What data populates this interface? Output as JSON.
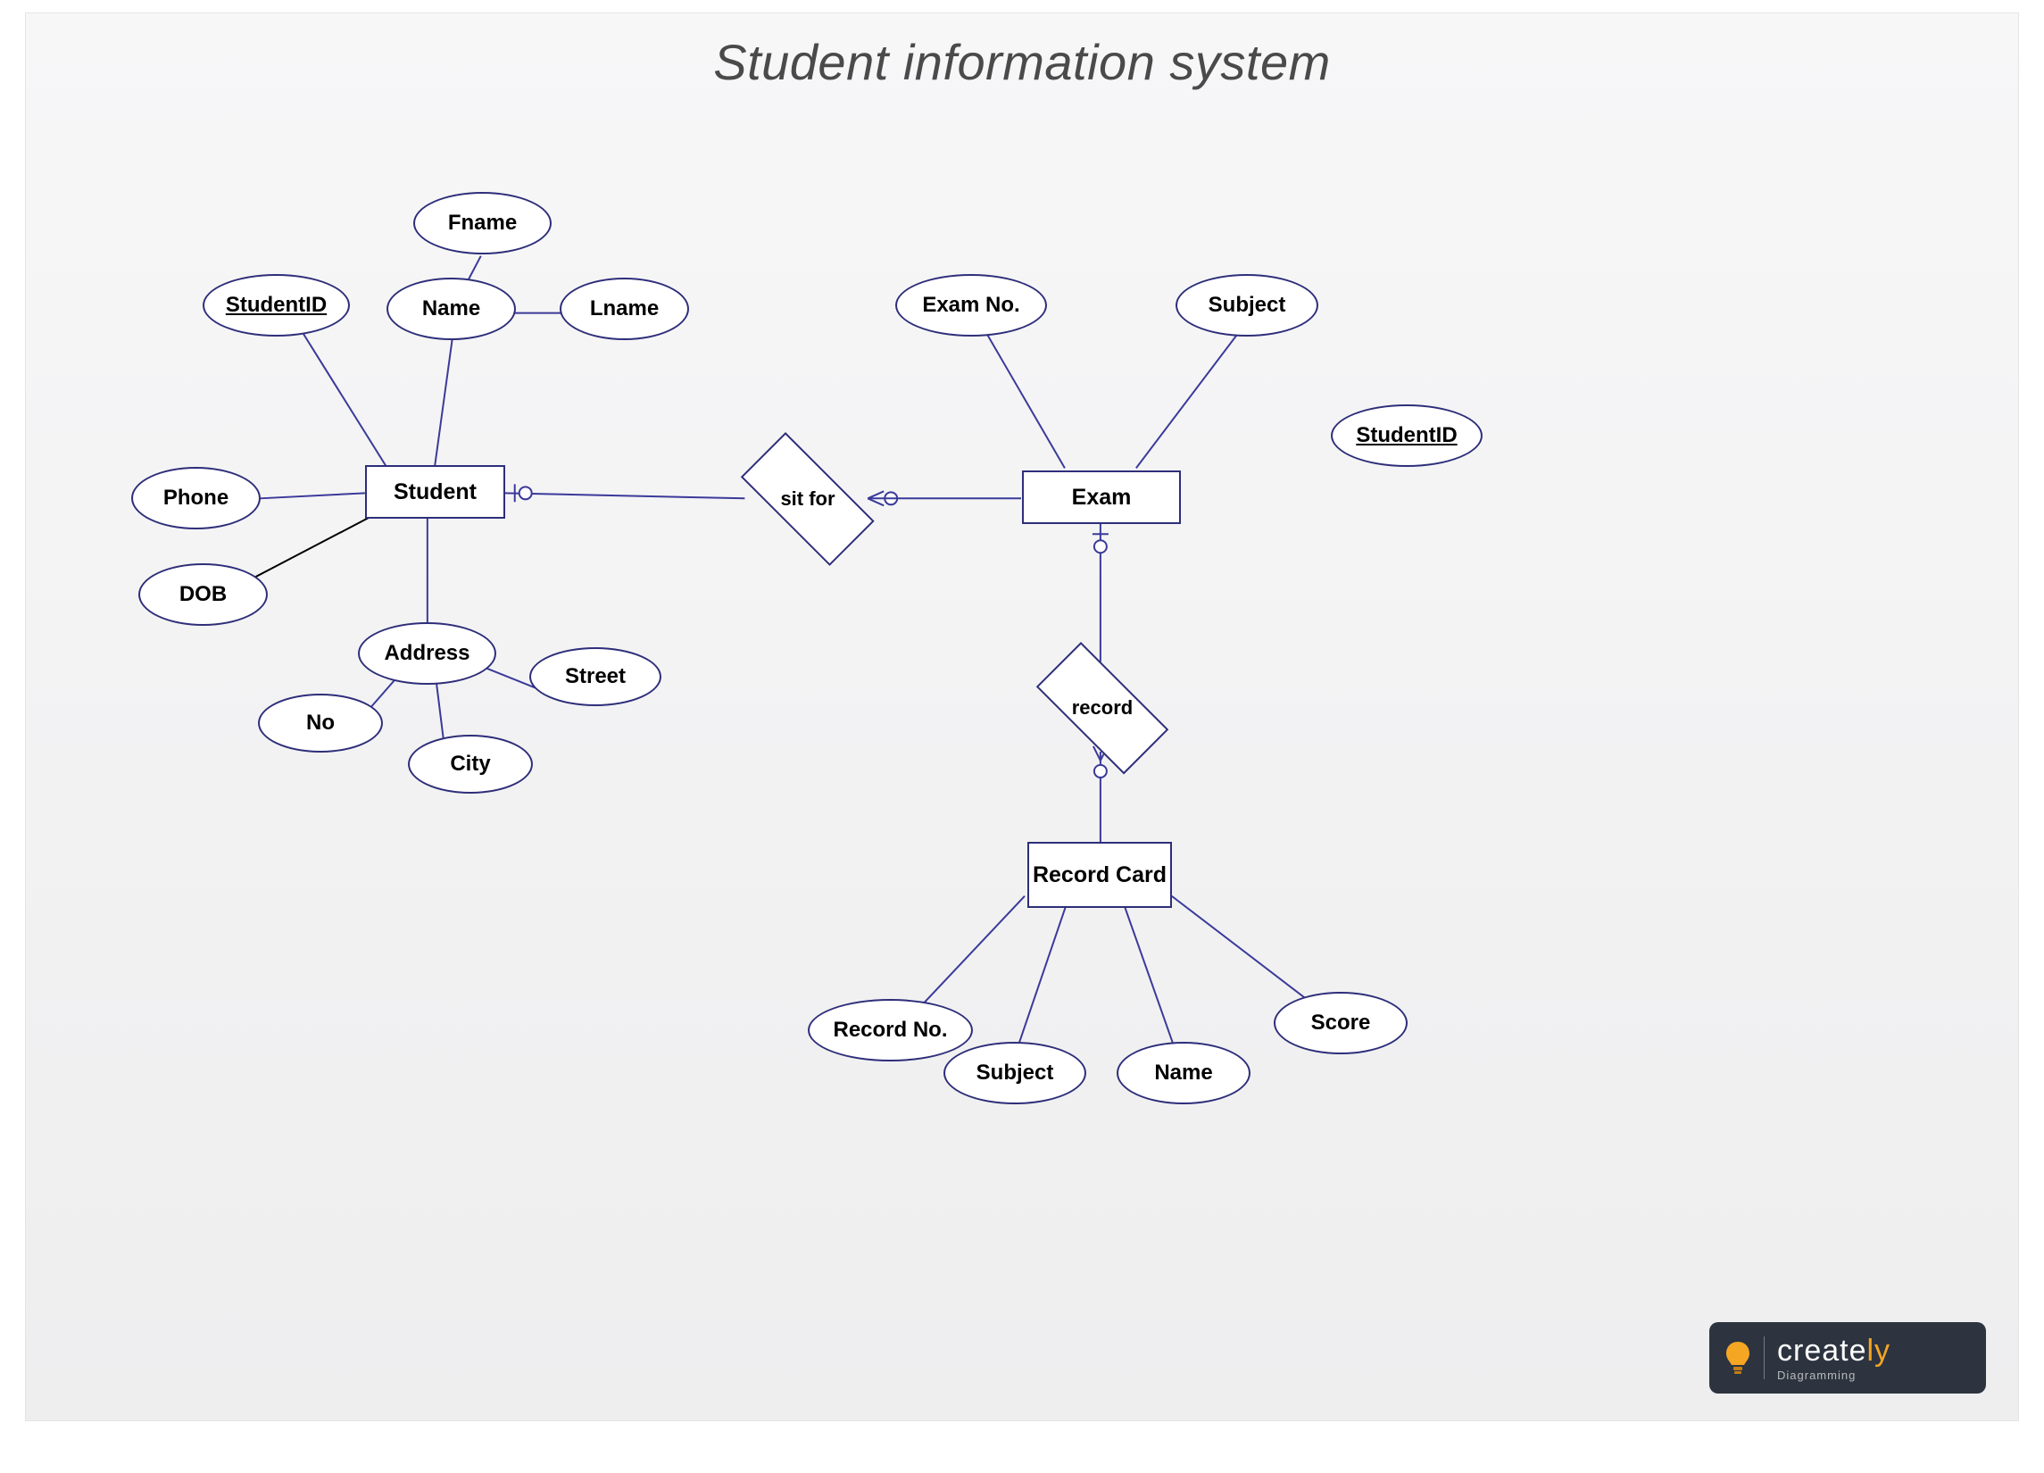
{
  "title": "Student information system",
  "entities": {
    "student": "Student",
    "exam": "Exam",
    "recordCard": "Record Card"
  },
  "relationships": {
    "sitFor": "sit for",
    "record": "record"
  },
  "attributes": {
    "studentId": "StudentID",
    "fname": "Fname",
    "name": "Name",
    "lname": "Lname",
    "phone": "Phone",
    "dob": "DOB",
    "address": "Address",
    "no": "No",
    "city": "City",
    "street": "Street",
    "examNo": "Exam No.",
    "subject": "Subject",
    "studentId2": "StudentID",
    "recordNo": "Record No.",
    "subject2": "Subject",
    "name2": "Name",
    "score": "Score"
  },
  "logo": {
    "brand1": "create",
    "brand2": "ly",
    "sub": "Diagramming"
  }
}
